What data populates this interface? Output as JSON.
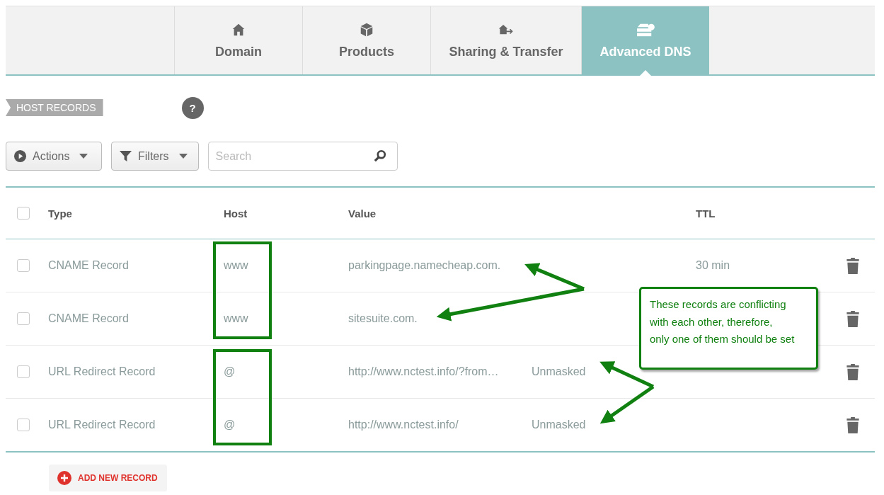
{
  "tabs": [
    {
      "label": "Domain",
      "kind": "house",
      "selected": false
    },
    {
      "label": "Products",
      "kind": "box",
      "selected": false
    },
    {
      "label": "Sharing & Transfer",
      "kind": "transfer",
      "selected": false
    },
    {
      "label": "Advanced DNS",
      "kind": "server",
      "selected": true
    }
  ],
  "section_label": "HOST RECORDS",
  "help": "?",
  "toolbar": {
    "actions": "Actions",
    "filters": "Filters",
    "search": {
      "placeholder": "Search"
    }
  },
  "table": {
    "columns": [
      "Type",
      "Host",
      "Value",
      "TTL"
    ],
    "header_checked": false,
    "rows": [
      {
        "type": "CNAME Record",
        "host": "www",
        "value": "parkingpage.namecheap.com.",
        "mode": "",
        "ttl": "30 min",
        "checked": false
      },
      {
        "type": "CNAME Record",
        "host": "www",
        "value": "sitesuite.com.",
        "mode": "",
        "ttl": "",
        "checked": false
      },
      {
        "type": "URL Redirect Record",
        "host": "@",
        "value": "http://www.nctest.info/?from…",
        "mode": "Unmasked",
        "ttl": "",
        "checked": false
      },
      {
        "type": "URL Redirect Record",
        "host": "@",
        "value": "http://www.nctest.info/",
        "mode": "Unmasked",
        "ttl": "",
        "checked": false
      }
    ]
  },
  "add_button": "ADD NEW RECORD",
  "callout": "These records are conflicting with each other, therefore, only one of them should be set"
}
